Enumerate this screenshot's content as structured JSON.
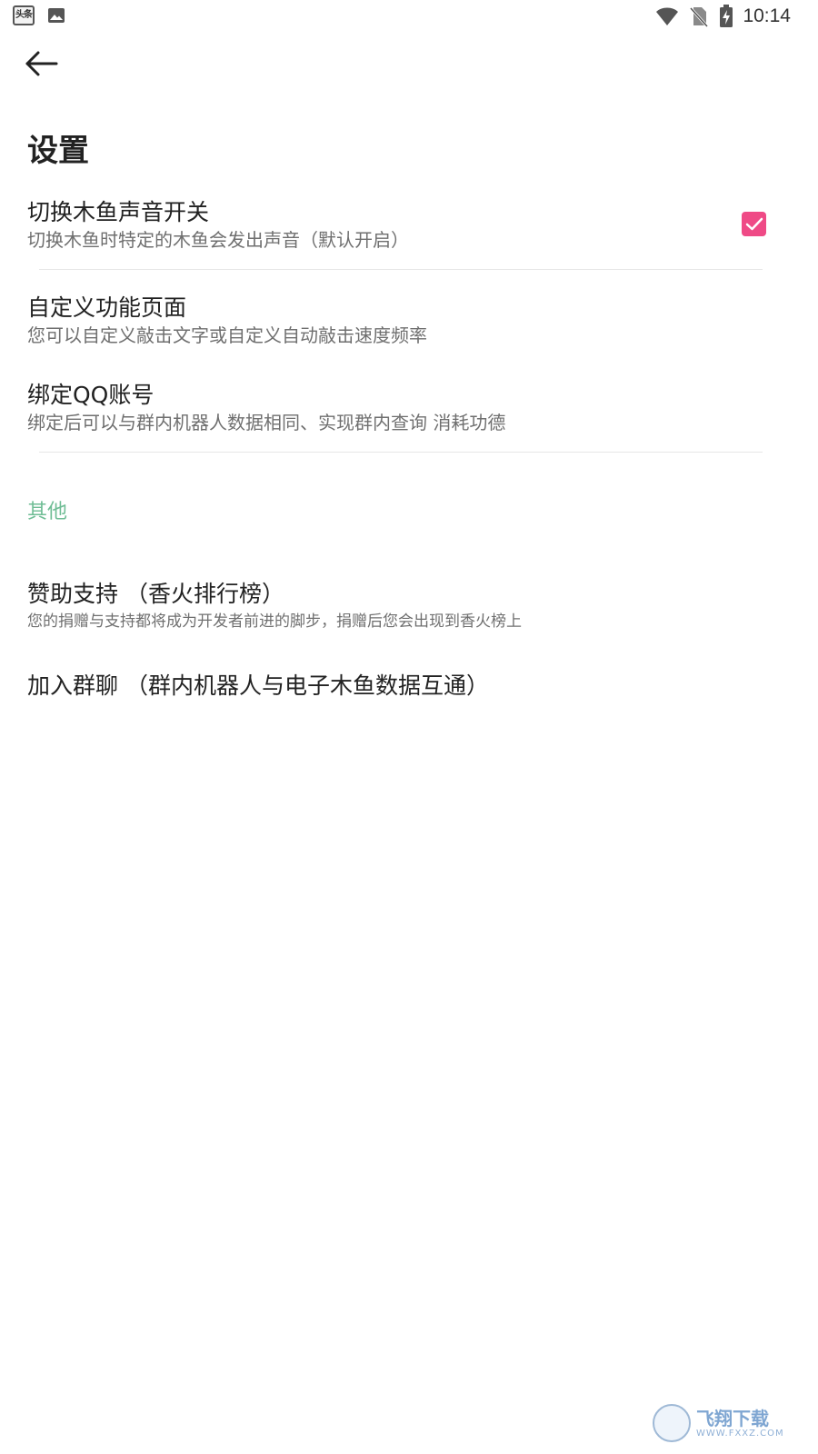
{
  "status_bar": {
    "toutiao_icon_text": "头条",
    "time": "10:14",
    "icons": [
      "toutiao-app-icon",
      "image-icon",
      "wifi-icon",
      "no-sim-icon",
      "battery-charging-icon"
    ]
  },
  "header": {
    "back_icon": "arrow-left-icon",
    "title": "设置"
  },
  "settings": {
    "sound_toggle": {
      "title": "切换木鱼声音开关",
      "summary": "切换木鱼时特定的木鱼会发出声音（默认开启）",
      "checked": true
    },
    "custom_page": {
      "title": "自定义功能页面",
      "summary": "您可以自定义敲击文字或自定义自动敲击速度频率"
    },
    "bind_qq": {
      "title": "绑定QQ账号",
      "summary": "绑定后可以与群内机器人数据相同、实现群内查询 消耗功德"
    }
  },
  "other": {
    "header": "其他",
    "sponsor": {
      "title": "赞助支持 （香火排行榜）",
      "summary": "您的捐赠与支持都将成为开发者前进的脚步，捐赠后您会出现到香火榜上"
    },
    "join_group": {
      "title": "加入群聊 （群内机器人与电子木鱼数据互通）"
    }
  },
  "watermark": {
    "title": "飞翔下载",
    "subtitle": "WWW.FXXZ.COM"
  },
  "colors": {
    "accent_pink": "#ef4a86",
    "section_green": "#6fbd95",
    "divider": "#e6e6e6"
  }
}
